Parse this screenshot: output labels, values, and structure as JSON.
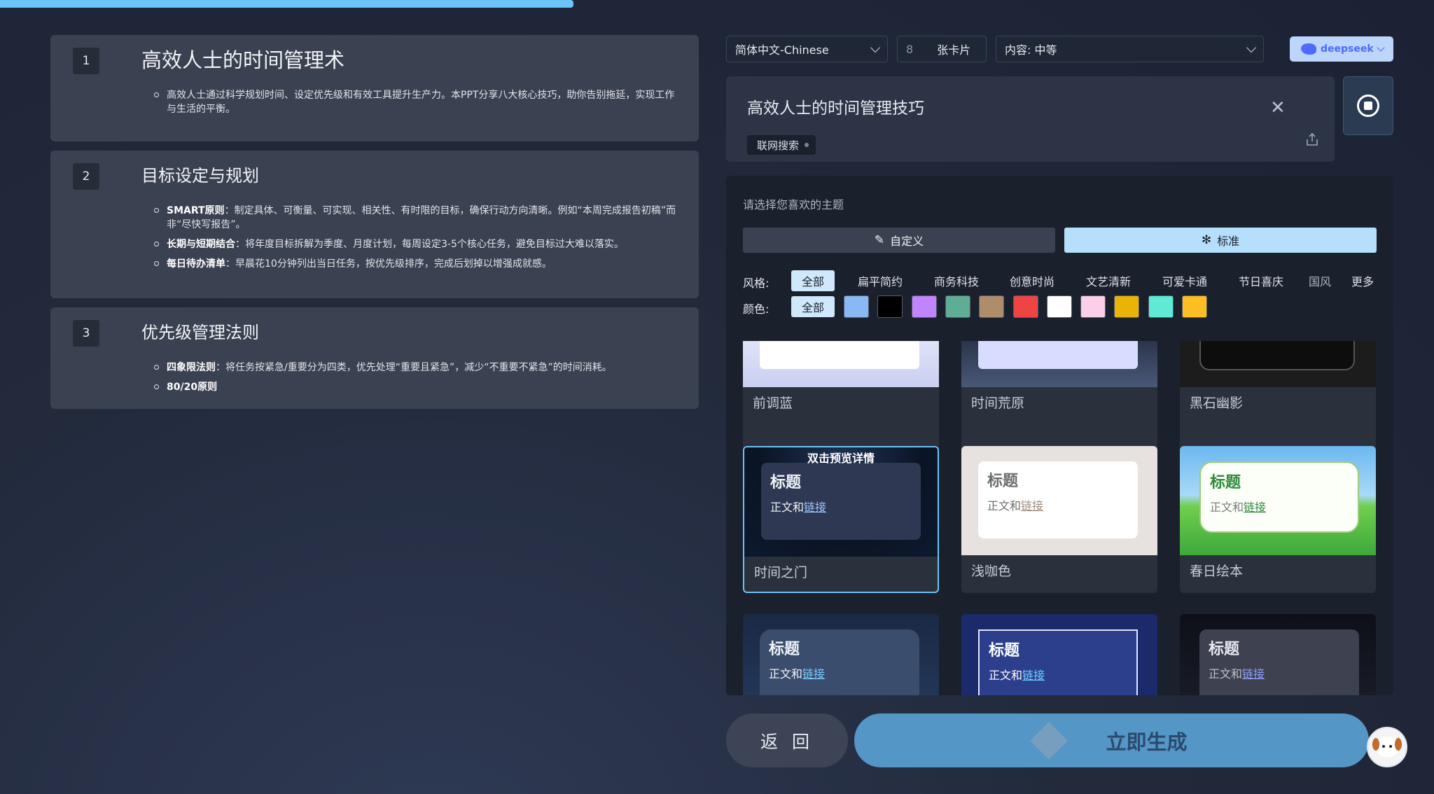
{
  "progress": {
    "percent": 40
  },
  "outline": [
    {
      "num": "1",
      "title": "高效人士的时间管理术",
      "points": [
        {
          "bold": "",
          "text": "高效人士通过科学规划时间、设定优先级和有效工具提升生产力。本PPT分享八大核心技巧，助你告别拖延，实现工作与生活的平衡。"
        }
      ]
    },
    {
      "num": "2",
      "title": "目标设定与规划",
      "points": [
        {
          "bold": "SMART原则",
          "text": "：制定具体、可衡量、可实现、相关性、有时限的目标，确保行动方向清晰。例如“本周完成报告初稿”而非“尽快写报告”。"
        },
        {
          "bold": "长期与短期结合",
          "text": "：将年度目标拆解为季度、月度计划，每周设定3-5个核心任务，避免目标过大难以落实。"
        },
        {
          "bold": "每日待办清单",
          "text": "：早晨花10分钟列出当日任务，按优先级排序，完成后划掉以增强成就感。"
        }
      ]
    },
    {
      "num": "3",
      "title": "优先级管理法则",
      "points": [
        {
          "bold": "四象限法则",
          "text": "：将任务按紧急/重要分为四类，优先处理“重要且紧急”，减少“不重要不紧急”的时间消耗。"
        },
        {
          "bold": "80/20原则",
          "text": ""
        }
      ]
    }
  ],
  "toolbar": {
    "language": "简体中文-Chinese",
    "card_count": "8",
    "card_unit": "张卡片",
    "content_level": "内容: 中等",
    "model": "deepseek"
  },
  "topic": {
    "text": "高效人士的时间管理技巧",
    "web_search": "联网搜索"
  },
  "themes": {
    "prompt": "请选择您喜欢的主题",
    "custom_label": "自定义",
    "standard_label": "标准",
    "style_label": "风格:",
    "color_label": "颜色:",
    "styles": [
      "全部",
      "扁平简约",
      "商务科技",
      "创意时尚",
      "文艺清新",
      "可爱卡通",
      "节日喜庆",
      "国风"
    ],
    "more": "更多",
    "color_all": "全部",
    "colors": [
      "#8ab8f5",
      "#000000",
      "#c084fc",
      "#5fae94",
      "#b08d6a",
      "#ef4444",
      "#ffffff",
      "#fbcfe8",
      "#eab308",
      "#5eead4",
      "#fbbf24"
    ],
    "preview_hint": "双击预览详情",
    "sample_title": "标题",
    "sample_body": "正文和",
    "sample_link": "链接",
    "cards": [
      "前调蓝",
      "时间荒原",
      "黑石幽影",
      "时间之门",
      "浅咖色",
      "春日绘本"
    ]
  },
  "actions": {
    "back": "返 回",
    "generate": "立即生成"
  }
}
